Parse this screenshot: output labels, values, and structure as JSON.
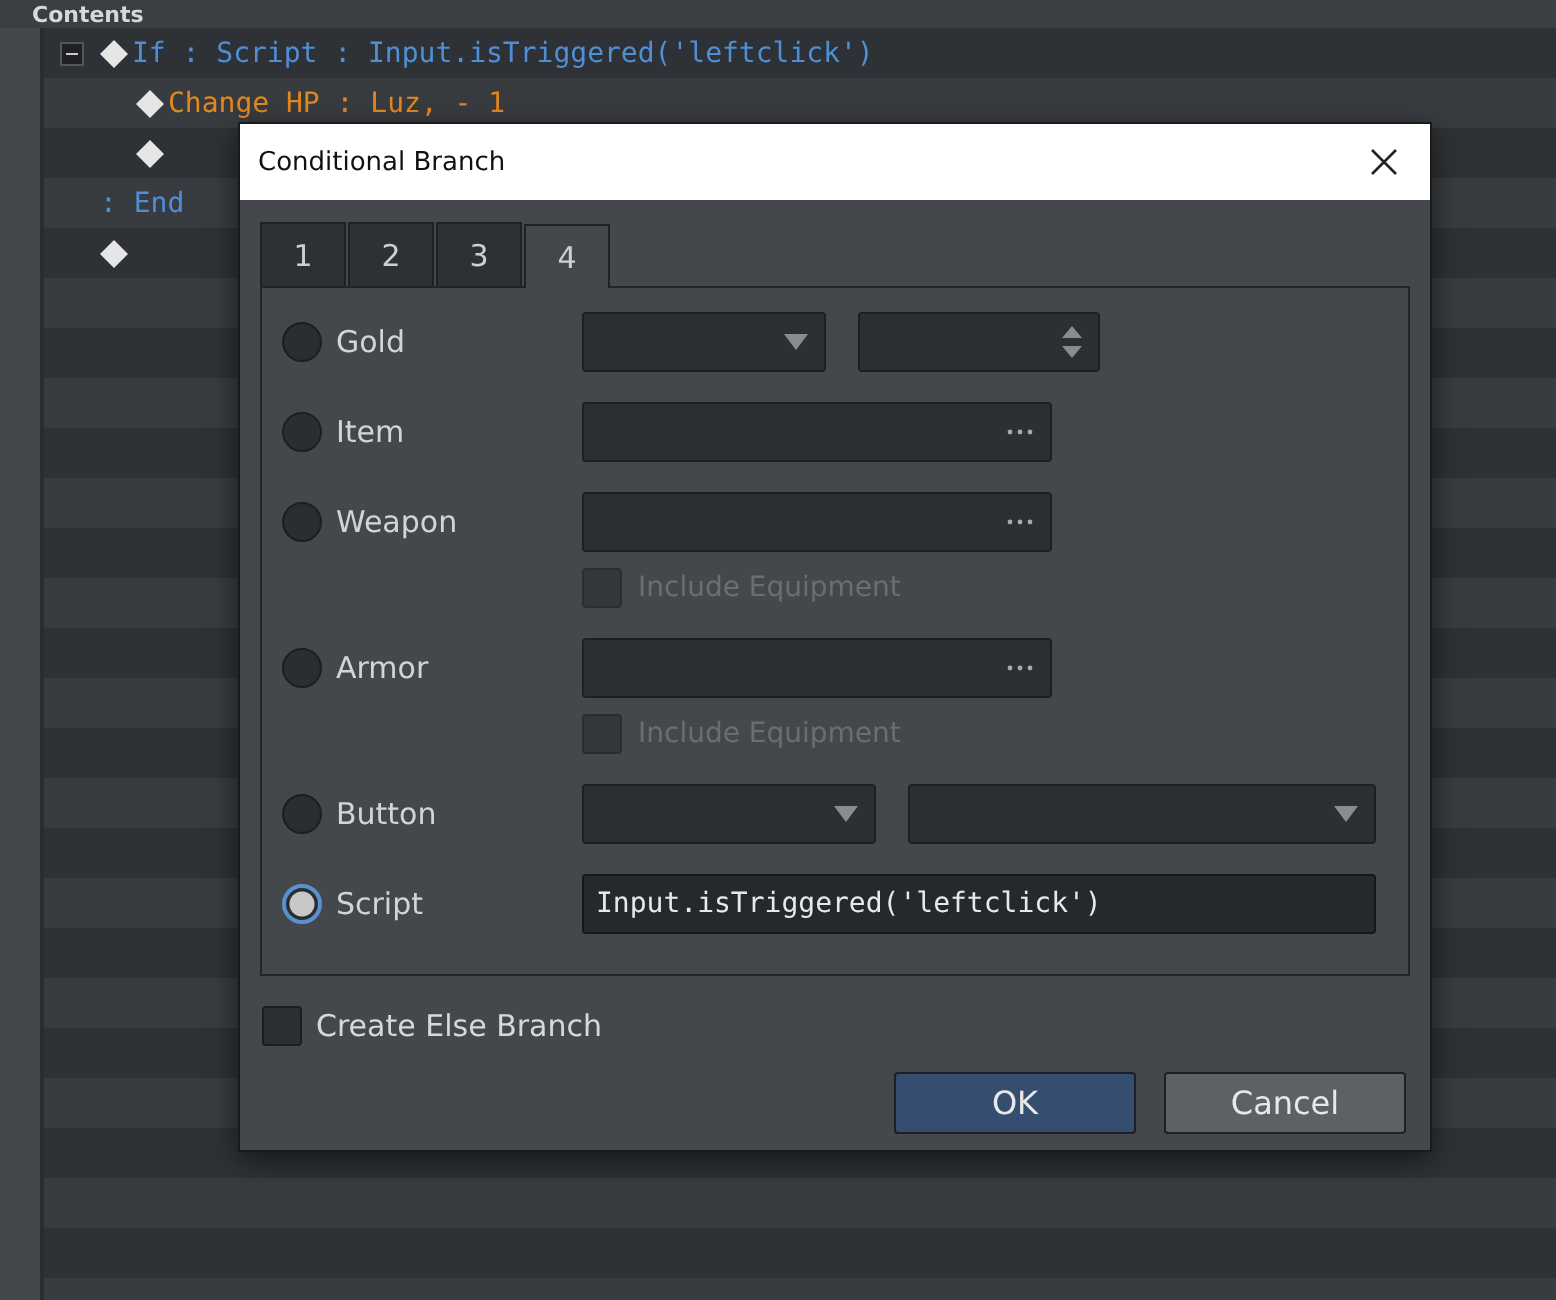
{
  "panel": {
    "title": "Contents"
  },
  "event_list": [
    {
      "kind": "command",
      "text": "If : Script : Input.isTriggered('leftclick')",
      "color": "#4f8fd6",
      "expanded": true,
      "children": [
        {
          "kind": "command",
          "text": "Change HP : Luz, - 1",
          "color": "#e2881f"
        },
        {
          "kind": "blank"
        }
      ]
    },
    {
      "kind": "end",
      "text": ": End",
      "color": "#4f8fd6"
    },
    {
      "kind": "blank"
    }
  ],
  "dialog": {
    "title": "Conditional Branch",
    "tabs": [
      {
        "label": "1",
        "selected": false
      },
      {
        "label": "2",
        "selected": false
      },
      {
        "label": "3",
        "selected": false
      },
      {
        "label": "4",
        "selected": true
      }
    ],
    "conditions": [
      {
        "kind": "select_spin",
        "label": "Gold",
        "selected": false
      },
      {
        "kind": "picker",
        "label": "Item",
        "selected": false
      },
      {
        "kind": "picker",
        "label": "Weapon",
        "selected": false,
        "include_equipment": {
          "label": "Include Equipment",
          "checked": false,
          "disabled": true
        }
      },
      {
        "kind": "picker",
        "label": "Armor",
        "selected": false,
        "include_equipment": {
          "label": "Include Equipment",
          "checked": false,
          "disabled": true
        }
      },
      {
        "kind": "two_selects",
        "label": "Button",
        "selected": false
      },
      {
        "kind": "text",
        "label": "Script",
        "selected": true,
        "value": "Input.isTriggered('leftclick')"
      }
    ],
    "else_branch": {
      "label": "Create Else Branch",
      "checked": false
    },
    "buttons": [
      {
        "label": "OK",
        "kind": "primary"
      },
      {
        "label": "Cancel",
        "kind": "normal"
      }
    ]
  }
}
